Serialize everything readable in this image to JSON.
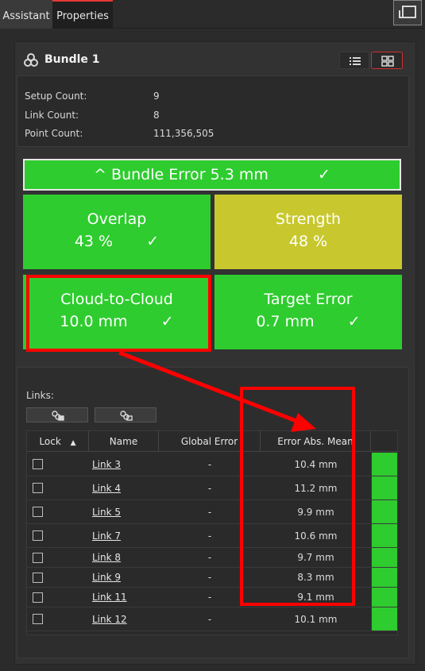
{
  "tabs": [
    {
      "label": "Assistant"
    },
    {
      "label": "Properties"
    }
  ],
  "header": {
    "title": "Bundle 1"
  },
  "counts": [
    {
      "label": "Setup Count:",
      "value": "9"
    },
    {
      "label": "Link Count:",
      "value": "8"
    },
    {
      "label": "Point Count:",
      "value": "111,356,505"
    }
  ],
  "bundle_error": {
    "label": "^ Bundle Error 5.3 mm",
    "check": "✓",
    "status": "green"
  },
  "tiles": {
    "overlap": {
      "title": "Overlap",
      "value": "43 %",
      "check": "✓",
      "color": "#2ecc2e"
    },
    "strength": {
      "title": "Strength",
      "value": "48 %",
      "check": "",
      "color": "#c8c82e"
    },
    "c2c": {
      "title": "Cloud-to-Cloud",
      "value": "10.0 mm",
      "check": "✓",
      "color": "#2ecc2e"
    },
    "target": {
      "title": "Target Error",
      "value": "0.7 mm",
      "check": "✓",
      "color": "#2ecc2e"
    }
  },
  "links": {
    "label": "Links:",
    "columns": [
      "Lock",
      "Name",
      "Global Error",
      "Error Abs. Mean"
    ],
    "rows": [
      {
        "name": "Link 3",
        "global": "-",
        "mean": "10.4 mm"
      },
      {
        "name": "Link 4",
        "global": "-",
        "mean": "11.2 mm"
      },
      {
        "name": "Link 5",
        "global": "-",
        "mean": "9.9 mm"
      },
      {
        "name": "Link 7",
        "global": "-",
        "mean": "10.6 mm"
      },
      {
        "name": "Link 8",
        "global": "-",
        "mean": "9.7 mm"
      },
      {
        "name": "Link 9",
        "global": "-",
        "mean": "8.3 mm"
      },
      {
        "name": "Link 11",
        "global": "-",
        "mean": "9.1 mm"
      },
      {
        "name": "Link 12",
        "global": "-",
        "mean": "10.1 mm"
      }
    ]
  },
  "colors": {
    "good": "#2ecc2e",
    "warn": "#c8c82e",
    "highlight": "#ff0000"
  }
}
